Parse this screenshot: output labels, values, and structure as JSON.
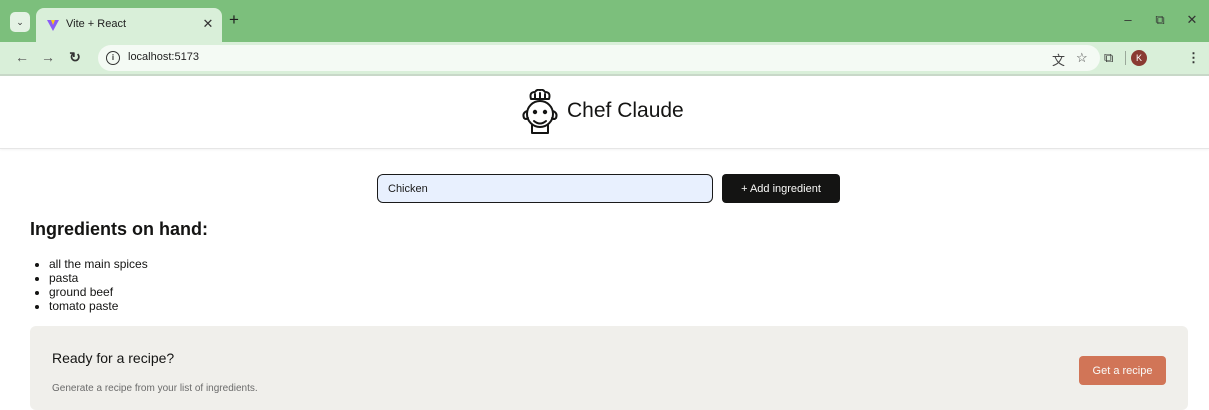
{
  "browser": {
    "tab_title": "Vite + React",
    "url": "localhost:5173",
    "profile_initial": "K",
    "colors": {
      "frame": "#7cbf7c",
      "toolbar": "#d9efd9"
    },
    "icons": [
      "tab-search-icon",
      "vite-favicon-icon",
      "close-icon",
      "plus-icon",
      "minimize-icon",
      "restore-icon",
      "window-close-icon",
      "back-arrow-icon",
      "forward-arrow-icon",
      "reload-icon",
      "site-info-icon",
      "translate-icon",
      "star-icon",
      "extensions-icon",
      "kebab-menu-icon"
    ]
  },
  "app": {
    "title": "Chef Claude",
    "logo_icon": "chef-icon"
  },
  "form": {
    "ingredient_value": "Chicken",
    "add_button_label": "+ Add ingredient"
  },
  "ingredients": {
    "heading": "Ingredients on hand:",
    "items": [
      "all the main spices",
      "pasta",
      "ground beef",
      "tomato paste"
    ]
  },
  "recipe_panel": {
    "title": "Ready for a recipe?",
    "subtitle": "Generate a recipe from your list of ingredients.",
    "button_label": "Get a recipe",
    "colors": {
      "panel_bg": "#f0efeb",
      "button_bg": "#d17557"
    }
  }
}
